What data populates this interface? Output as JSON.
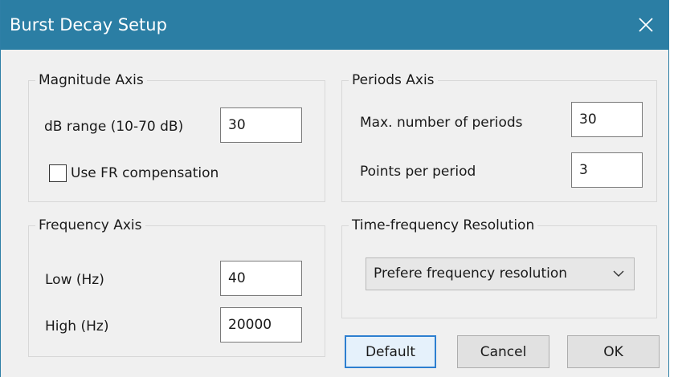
{
  "window": {
    "title": "Burst Decay Setup",
    "close_icon": "close-icon"
  },
  "magnitude_axis": {
    "title": "Magnitude Axis",
    "db_range_label": "dB range (10-70 dB)",
    "db_range_value": "30",
    "fr_compensation_label": "Use FR compensation",
    "fr_compensation_checked": false
  },
  "periods_axis": {
    "title": "Periods Axis",
    "max_periods_label": "Max. number of periods",
    "max_periods_value": "30",
    "points_per_period_label": "Points per period",
    "points_per_period_value": "3"
  },
  "frequency_axis": {
    "title": "Frequency Axis",
    "low_label": "Low (Hz)",
    "low_value": "40",
    "high_label": "High (Hz)",
    "high_value": "20000"
  },
  "time_frequency_resolution": {
    "title": "Time-frequency Resolution",
    "selected": "Prefere frequency resolution",
    "dropdown_icon": "chevron-down-icon"
  },
  "buttons": {
    "default_label": "Default",
    "cancel_label": "Cancel",
    "ok_label": "OK"
  },
  "colors": {
    "titlebar": "#2b7ea4",
    "dialog_bg": "#f0f0f0",
    "default_button_border": "#2d7fd0"
  }
}
